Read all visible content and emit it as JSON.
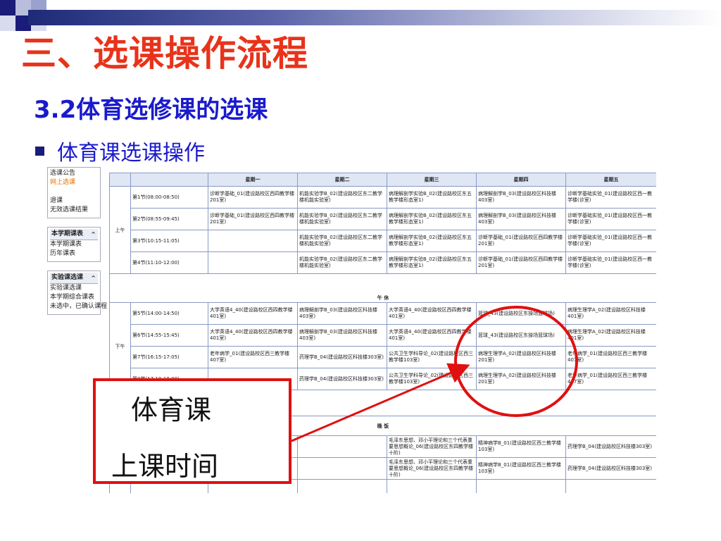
{
  "slide": {
    "title": "三、选课操作流程",
    "subtitle": "3.2体育选修课的选课",
    "bullet": "体育课选课操作"
  },
  "menu": {
    "section1": {
      "items": [
        {
          "label": "选课公告",
          "active": false
        },
        {
          "label": "网上选课",
          "active": true
        },
        {
          "label": "",
          "active": true
        },
        {
          "label": "退课",
          "active": false
        },
        {
          "label": "无效选课结果",
          "active": false
        }
      ]
    },
    "section2": {
      "header": "本学期课表",
      "items": [
        {
          "label": "本学期课表"
        },
        {
          "label": "历年课表"
        }
      ]
    },
    "section3": {
      "header": "实验课选课",
      "items": [
        {
          "label": "实验课选课"
        },
        {
          "label": "本学期综合课表"
        },
        {
          "label": "未选中，已确认课程"
        }
      ]
    }
  },
  "schedule": {
    "days": [
      "星期一",
      "星期二",
      "星期三",
      "星期四",
      "星期五"
    ],
    "morning_label": "上午",
    "afternoon_label": "下午",
    "noon_break": "午 休",
    "evening_break": "晚 饭",
    "periods": [
      {
        "time": "第1节(08:00-08:50)",
        "cells": [
          "诊断学基础_01(建设路校区西四教学楼201室)",
          "机能实验学B_02(建设路校区东二教学楼机能实验室)",
          "病理解剖学实验B_02(建设路校区东五教学楼形态室1)",
          "病理解剖学B_03(建设路校区科技楼403室)",
          "诊断学基础实验_01(建设路校区西一教学楼(诊室)"
        ]
      },
      {
        "time": "第2节(08:55-09:45)",
        "cells": [
          "诊断学基础_01(建设路校区西四教学楼201室)",
          "机能实验学B_02(建设路校区东二教学楼机能实验室)",
          "病理解剖学实验B_02(建设路校区东五教学楼形态室1)",
          "病理解剖学B_03(建设路校区科技楼403室)",
          "诊断学基础实验_01(建设路校区西一教学楼(诊室)"
        ]
      },
      {
        "time": "第3节(10:15-11:05)",
        "cells": [
          "",
          "机能实验学B_02(建设路校区东二教学楼机能实验室)",
          "病理解剖学实验B_02(建设路校区东五教学楼形态室1)",
          "诊断学基础_01(建设路校区西四教学楼201室)",
          "诊断学基础实验_01(建设路校区西一教学楼(诊室)"
        ]
      },
      {
        "time": "第4节(11:10-12:00)",
        "cells": [
          "",
          "机能实验学B_02(建设路校区东二教学楼机能实验室)",
          "病理解剖学实验B_02(建设路校区东五教学楼形态室1)",
          "诊断学基础_01(建设路校区西四教学楼201室)",
          "诊断学基础实验_01(建设路校区西一教学楼(诊室)"
        ]
      },
      {
        "time": "第5节(14:00-14:50)",
        "cells": [
          "大学英语4_40(建设路校区西四教学楼401室)",
          "病理解剖学B_03(建设路校区科技楼403室)",
          "大学英语4_40(建设路校区西四教学楼401室)",
          "篮球_43(建设路校区东操场篮球场)",
          "病理生理学A_02(建设路校区科技楼401室)"
        ]
      },
      {
        "time": "第6节(14:55-15:45)",
        "cells": [
          "大学英语4_40(建设路校区西四教学楼401室)",
          "病理解剖学B_03(建设路校区科技楼403室)",
          "大学英语4_40(建设路校区西四教学楼401室)",
          "篮球_43(建设路校区东操场篮球场)",
          "病理生理学A_02(建设路校区科技楼401室)"
        ]
      },
      {
        "time": "第7节(16:15-17:05)",
        "cells": [
          "老年病学_01(建设路校区西三教学楼407室)",
          "药理学B_04(建设路校区科技楼303室)",
          "公共卫生学科导论_02(建设路校区西三教学楼103室)",
          "病理生理学A_02(建设路校区科技楼201室)",
          "老年病学_01(建设路校区西三教学楼407室)"
        ]
      },
      {
        "time": "第8节(17:10-18:00)",
        "cells": [
          "",
          "药理学B_04(建设路校区科技楼303室)",
          "公共卫生学科导论_02(建设路校区西三教学楼103室)",
          "病理生理学A_02(建设路校区科技楼201室)",
          "老年病学_01(建设路校区西三教学楼407室)"
        ]
      }
    ],
    "evening": [
      {
        "time": "",
        "cells": [
          "",
          "",
          "毛泽东思想、邓小平理论和三个代表重要思想概论_06(建设路校区东四教学楼十阶)",
          "精神病学B_01(建设路校区西三教学楼103室)",
          "药理学B_04(建设路校区科技楼303室)"
        ]
      },
      {
        "time": "",
        "cells": [
          "",
          "",
          "毛泽东思想、邓小平理论和三个代表重要思想概论_06(建设路校区东四教学楼十阶)",
          "精神病学B_01(建设路校区西三教学楼103室)",
          "药理学B_04(建设路校区科技楼303室)"
        ]
      },
      {
        "time": "",
        "cells": [
          "",
          "",
          "",
          "",
          ""
        ]
      }
    ]
  },
  "annotation": {
    "line1": "体育课",
    "line2": "上课时间",
    "border_color": "#e01010"
  },
  "colors": {
    "title": "#e8331a",
    "subtitle": "#1a1acc",
    "header_bar": "#1e2a78"
  }
}
